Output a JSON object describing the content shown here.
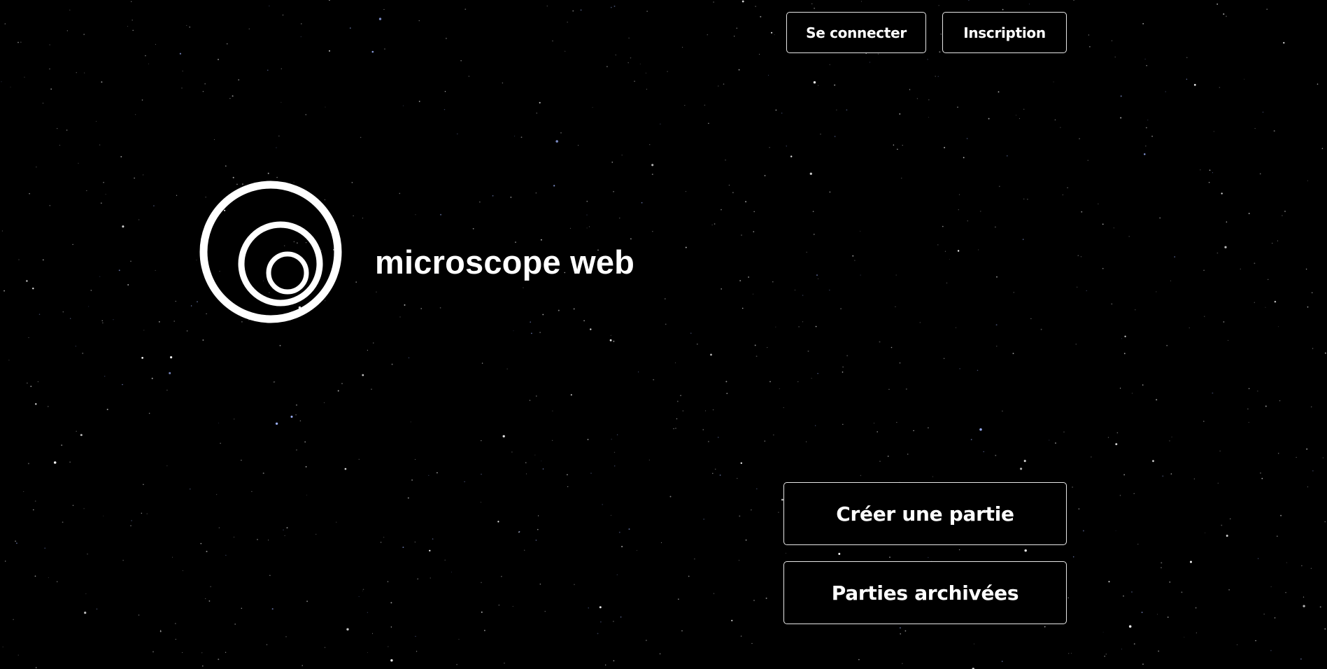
{
  "header": {
    "login_label": "Se connecter",
    "signup_label": "Inscription"
  },
  "brand": {
    "logo_icon": "concentric-circles-logo-icon",
    "name": "microscope web"
  },
  "actions": {
    "create_label": "Créer une partie",
    "archive_label": "Parties archivées"
  },
  "colors": {
    "background": "#000000",
    "foreground": "#ffffff",
    "button_border": "#e6e6e6"
  }
}
